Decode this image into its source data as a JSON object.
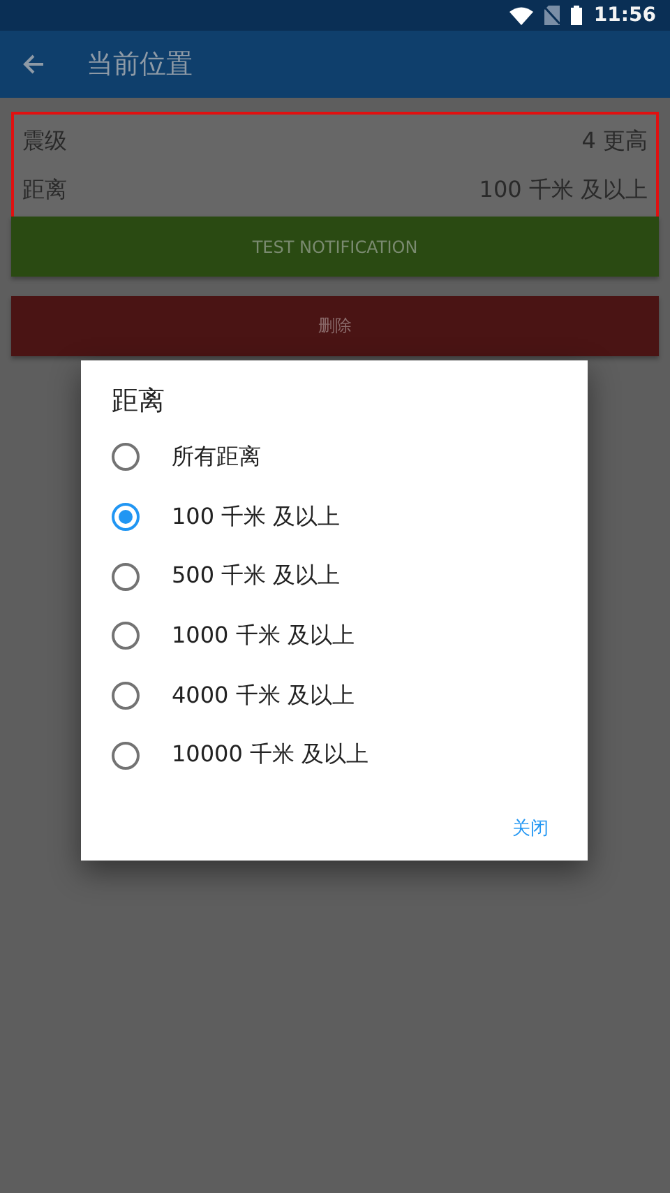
{
  "status_bar": {
    "time": "11:56"
  },
  "app_bar": {
    "title": "当前位置"
  },
  "settings": [
    {
      "label": "震级",
      "value": "4 更高"
    },
    {
      "label": "距离",
      "value": "100 千米 及以上"
    }
  ],
  "buttons": [
    {
      "kind": "test",
      "label": "TEST NOTIFICATION"
    },
    {
      "kind": "delete",
      "label": "删除"
    }
  ],
  "dialog": {
    "title": "距离",
    "options": [
      {
        "label": "所有距离",
        "selected": false
      },
      {
        "label": "100 千米 及以上",
        "selected": true
      },
      {
        "label": "500 千米 及以上",
        "selected": false
      },
      {
        "label": "1000 千米 及以上",
        "selected": false
      },
      {
        "label": "4000 千米 及以上",
        "selected": false
      },
      {
        "label": "10000 千米 及以上",
        "selected": false
      }
    ],
    "close": "关闭"
  }
}
